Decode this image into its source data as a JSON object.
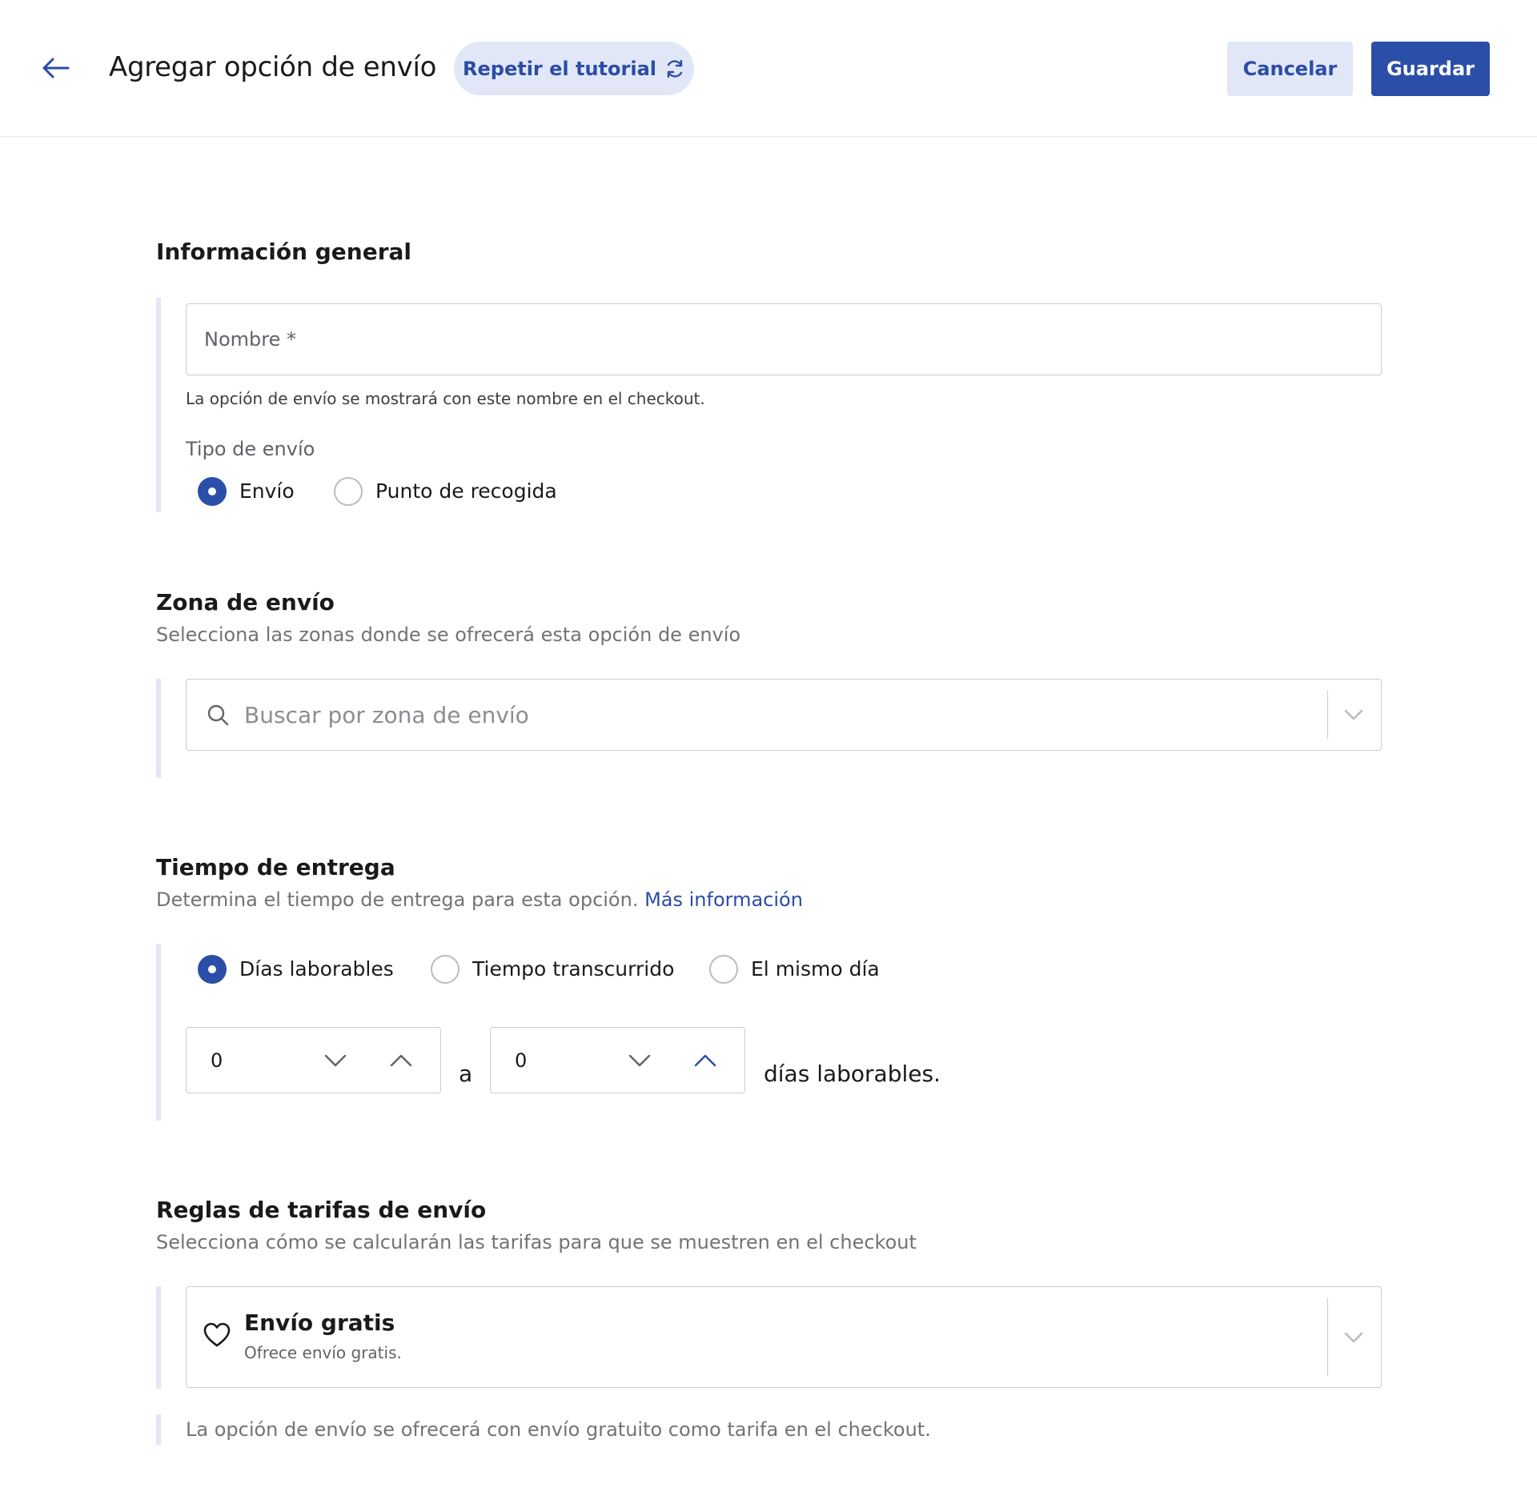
{
  "header": {
    "title": "Agregar opción de envío",
    "tutorial_label": "Repetir el tutorial",
    "cancel_label": "Cancelar",
    "save_label": "Guardar"
  },
  "general": {
    "title": "Información general",
    "name_label": "Nombre *",
    "name_value": "",
    "name_helper": "La opción de envío se mostrará con este nombre en el checkout.",
    "type_label": "Tipo de envío",
    "type_options": [
      {
        "label": "Envío",
        "checked": true
      },
      {
        "label": "Punto de recogida",
        "checked": false
      }
    ]
  },
  "zone": {
    "title": "Zona de envío",
    "subtitle": "Selecciona las zonas donde se ofrecerá esta opción de envío",
    "search_placeholder": "Buscar por zona de envío"
  },
  "delivery": {
    "title": "Tiempo de entrega",
    "subtitle": "Determina el tiempo de entrega para esta opción.",
    "link": "Más información",
    "options": [
      {
        "label": "Días laborables",
        "checked": true
      },
      {
        "label": "Tiempo transcurrido",
        "checked": false
      },
      {
        "label": "El mismo día",
        "checked": false
      }
    ],
    "from_value": "0",
    "connector": "a",
    "to_value": "0",
    "unit": "días laborables."
  },
  "rates": {
    "title": "Reglas de tarifas de envío",
    "subtitle": "Selecciona cómo se calcularán las tarifas para que se muestren en el checkout",
    "selected_title": "Envío gratis",
    "selected_desc": "Ofrece envío gratis.",
    "note": "La opción de envío se ofrecerá con envío gratuito como tarifa en el checkout."
  },
  "colors": {
    "primary": "#2b4fa9",
    "primary_light": "#e1e7f7",
    "border": "#c9ccd3",
    "muted_text": "#737373"
  },
  "icons": [
    "arrow-left-icon",
    "refresh-icon",
    "search-icon",
    "chevron-down-icon",
    "chevron-up-icon",
    "heart-icon"
  ]
}
